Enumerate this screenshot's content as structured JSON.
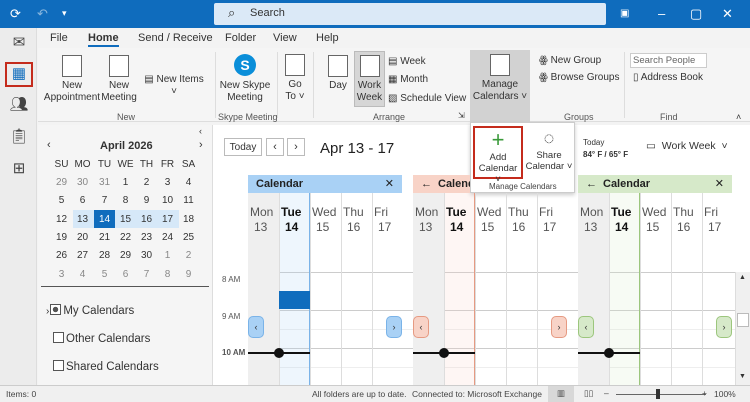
{
  "titlebar": {
    "search_placeholder": "Search",
    "icons": [
      "sync-icon",
      "undo-icon",
      "customize-icon",
      "coauthor-icon",
      "minimize-icon",
      "maximize-icon",
      "close-icon"
    ]
  },
  "rail": [
    "mail-icon",
    "calendar-icon",
    "people-icon",
    "tasks-icon",
    "apps-icon"
  ],
  "tabs": [
    "File",
    "Home",
    "Send / Receive",
    "Folder",
    "View",
    "Help"
  ],
  "ribbon": {
    "new_appointment": "New Appointment",
    "new_meeting": "New Meeting",
    "new_items": "New Items",
    "group_new": "New",
    "new_skype": "New Skype Meeting",
    "group_skype": "Skype Meeting",
    "goto": "Go To",
    "day": "Day",
    "work_week": "Work Week",
    "week": "Week",
    "month": "Month",
    "schedule_view": "Schedule View",
    "group_arrange": "Arrange",
    "manage_calendars": "Manage Calendars",
    "new_group": "New Group",
    "browse_groups": "Browse Groups",
    "group_groups": "Groups",
    "search_people_placeholder": "Search People",
    "address_book": "Address Book",
    "group_find": "Find"
  },
  "popup": {
    "add_calendar": "Add Calendar",
    "share_calendar": "Share Calendar",
    "label": "Manage Calendars"
  },
  "minical": {
    "title": "April 2026",
    "weekdays": [
      "SU",
      "MO",
      "TU",
      "WE",
      "TH",
      "FR",
      "SA"
    ],
    "weeks": [
      [
        "29",
        "30",
        "31",
        "1",
        "2",
        "3",
        "4"
      ],
      [
        "5",
        "6",
        "7",
        "8",
        "9",
        "10",
        "11"
      ],
      [
        "12",
        "13",
        "14",
        "15",
        "16",
        "17",
        "18"
      ],
      [
        "19",
        "20",
        "21",
        "22",
        "23",
        "24",
        "25"
      ],
      [
        "26",
        "27",
        "28",
        "29",
        "30",
        "1",
        "2"
      ],
      [
        "3",
        "4",
        "5",
        "6",
        "7",
        "8",
        "9"
      ]
    ],
    "today": "14",
    "selected_week": 2
  },
  "folders": [
    {
      "label": "My Calendars",
      "checked": "partial"
    },
    {
      "label": "Other Calendars",
      "checked": false
    },
    {
      "label": "Shared Calendars",
      "checked": false
    }
  ],
  "main": {
    "today_btn": "Today",
    "date_range": "Apr 13 - 17",
    "weather_label": "Today",
    "weather": "84° F / 65° F",
    "view": "Work Week",
    "times": [
      "8 AM",
      "9 AM",
      "10 AM"
    ],
    "calendars": [
      {
        "name": "Calendar",
        "color": "#a9d1f5",
        "accent": "#7ab3e8"
      },
      {
        "name": "Calendar",
        "color": "#f8d3c7",
        "accent": "#e69a82"
      },
      {
        "name": "Calendar",
        "color": "#d6e9c9",
        "accent": "#9cc67d"
      }
    ],
    "days": [
      {
        "name": "Mon",
        "num": "13"
      },
      {
        "name": "Tue",
        "num": "14"
      },
      {
        "name": "Wed",
        "num": "15"
      },
      {
        "name": "Thu",
        "num": "16"
      },
      {
        "name": "Fri",
        "num": "17"
      }
    ]
  },
  "status": {
    "items": "Items: 0",
    "sync": "All folders are up to date.",
    "connection": "Connected to: Microsoft Exchange",
    "zoom": "100%"
  }
}
